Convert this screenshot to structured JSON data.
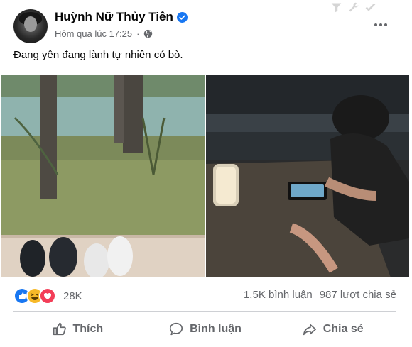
{
  "post": {
    "author_name": "Huỳnh Nữ Thủy Tiên",
    "timestamp": "Hôm qua lúc 17:25",
    "audience_icon": "globe-icon",
    "text": "Đang yên đang lành tự nhiên có bò."
  },
  "engagement": {
    "reactions": [
      "like-reaction-icon",
      "haha-reaction-icon",
      "love-reaction-icon"
    ],
    "reaction_count": "28K",
    "comments": "1,5K bình luận",
    "shares": "987 lượt chia sẻ"
  },
  "actions": {
    "like_label": "Thích",
    "comment_label": "Bình luận",
    "share_label": "Chia sẻ"
  },
  "colors": {
    "verified_blue": "#1877f2",
    "muted_text": "#65676b",
    "like_blue": "#1877f2",
    "haha_yellow": "#f7b928",
    "love_red": "#f33e58"
  }
}
